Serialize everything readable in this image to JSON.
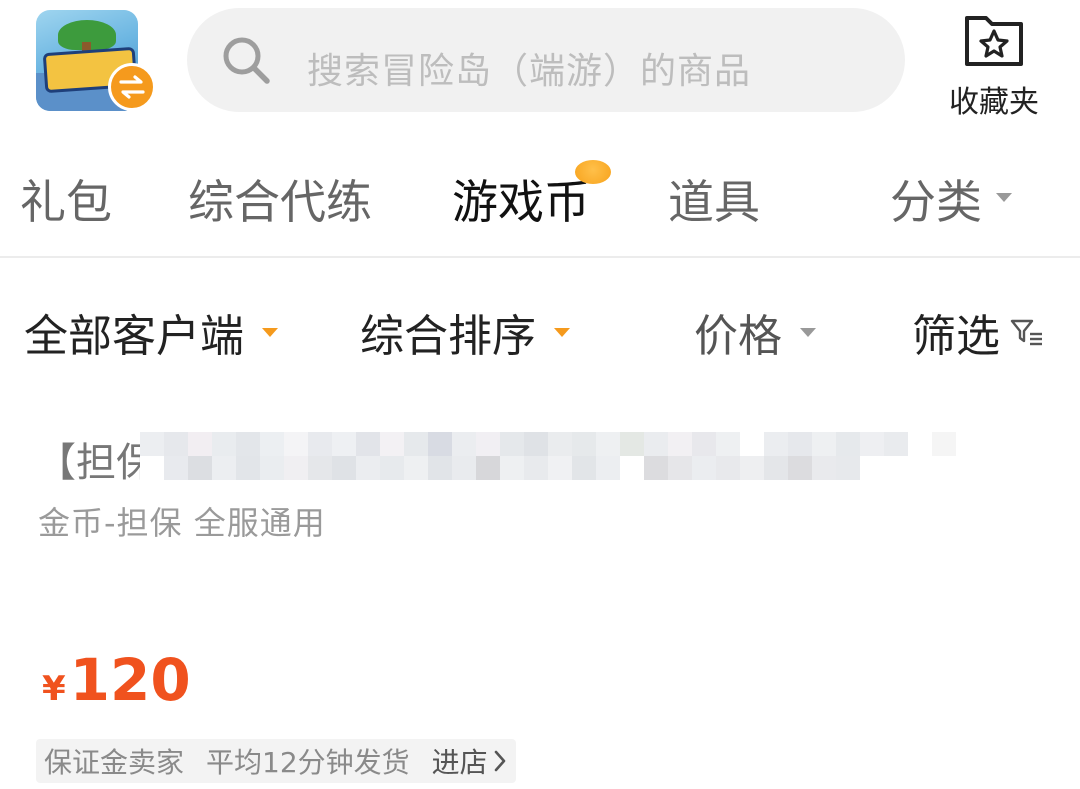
{
  "header": {
    "search_placeholder": "搜索冒险岛（端游）的商品",
    "favorites_label": "收藏夹"
  },
  "tabs": [
    {
      "label": "礼包",
      "active": false
    },
    {
      "label": "综合代练",
      "active": false
    },
    {
      "label": "游戏币",
      "active": true
    },
    {
      "label": "道具",
      "active": false
    },
    {
      "label": "分类",
      "active": false
    }
  ],
  "filters": {
    "client": "全部客户端",
    "sort": "综合排序",
    "price": "价格",
    "screen": "筛选"
  },
  "listing": {
    "title_prefix": "【担保",
    "subtitle": "金币-担保 全服通用",
    "currency": "¥",
    "price": "120",
    "seller_badge": "保证金卖家",
    "delivery": "平均12分钟发货",
    "shop_link": "进店"
  },
  "colors": {
    "accent_orange": "#f59a1d",
    "price_red": "#f0521e",
    "search_bg": "#f1f1f1"
  }
}
